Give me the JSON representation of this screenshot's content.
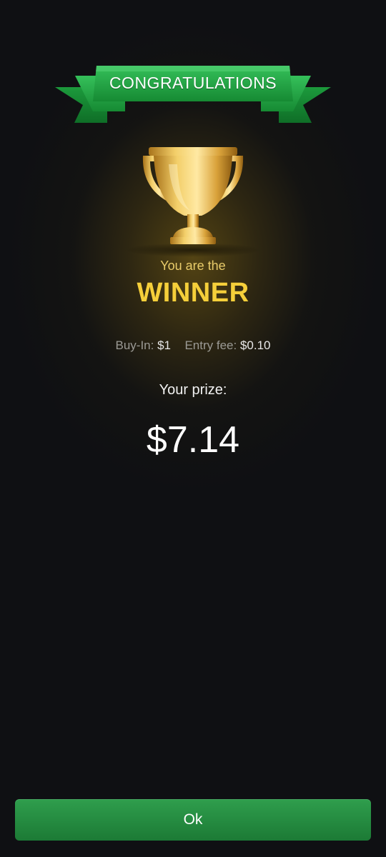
{
  "banner": {
    "title": "CONGRATULATIONS"
  },
  "result": {
    "subtitle": "You are the",
    "headline": "WINNER"
  },
  "fees": {
    "buy_in_label": "Buy-In:",
    "buy_in_value": "$1",
    "entry_fee_label": "Entry fee:",
    "entry_fee_value": "$0.10"
  },
  "prize": {
    "label": "Your prize:",
    "amount": "$7.14"
  },
  "actions": {
    "ok_label": "Ok"
  },
  "icons": {
    "trophy": "trophy-icon",
    "ribbon": "ribbon-banner"
  },
  "colors": {
    "background": "#0f1013",
    "ribbon_green": "#1f9a3e",
    "winner_gold": "#f5cf3a",
    "button_green": "#2a9446"
  }
}
